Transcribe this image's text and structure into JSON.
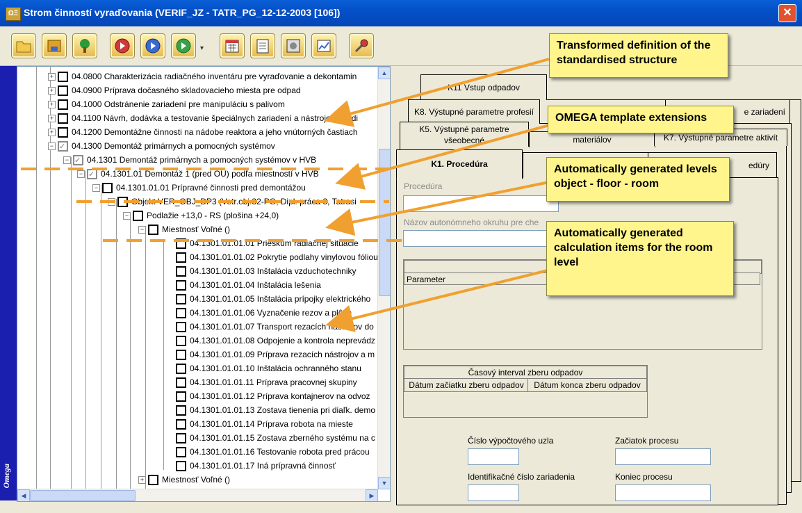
{
  "window": {
    "title": "Strom činností vyraďovania (VERIF_JZ - TATR_PG_12-12-2003 [106])",
    "app_icon": "ΩΞ",
    "close_glyph": "✕"
  },
  "toolbar": {
    "buttons": [
      "folder-open-icon",
      "save-icon",
      "tree-icon",
      "play-red-icon",
      "play-blue-icon",
      "play-green-icon",
      "calendar-icon",
      "document-icon",
      "settings-icon",
      "chart-icon",
      "tools-icon"
    ],
    "dropdown_glyph": "▾"
  },
  "sidebar_logo": "Omega",
  "tree": {
    "rows": [
      {
        "text": "04.0800 Charakterizácia radiačného inventáru pre vyraďovanie a dekontamin"
      },
      {
        "text": "04.0900 Príprava dočasného skladovacieho miesta pre odpad"
      },
      {
        "text": "04.1000 Odstránenie zariadení pre manipuláciu s palivom"
      },
      {
        "text": "04.1100 Návrh, dodávka a testovanie špeciálnych zariadení a nástrojov pre di"
      },
      {
        "text": "04.1200 Demontážne činnosti na nádobe reaktora a jeho vnútorných častiach"
      },
      {
        "text": "04.1300 Demontáž primárnych a pomocných systémov"
      },
      {
        "text": "04.1301 Demontáž primárnych a pomocných systémov v HVB"
      },
      {
        "text": "04.1301.01 Demontáž 1 (pred OU) podľa miestností v HVB"
      },
      {
        "text": "04.1301.01.01 Prípravné činnosti pred demontážou"
      },
      {
        "text": "Objekt VER_OBJ_DP3 (Vetr.obj.32-PG, Dipl. práca 3, Tatrasi"
      },
      {
        "text": "Podlažie +13,0 - RS (plošina +24,0)"
      },
      {
        "text": "Miestnosť Voľné ()"
      },
      {
        "text": "04.1301.01.01.01 Prieskum radiačnej situácie"
      },
      {
        "text": "04.1301.01.01.02 Pokrytie podlahy vinylovou fóliou"
      },
      {
        "text": "04.1301.01.01.03 Inštalácia vzduchotechniky"
      },
      {
        "text": "04.1301.01.01.04 Inštalácia lešenia"
      },
      {
        "text": "04.1301.01.01.05 Inštalácia prípojky elektrického"
      },
      {
        "text": "04.1301.01.01.06 Vyznačenie rezov a plôch"
      },
      {
        "text": "04.1301.01.01.07 Transport rezacích nástrojov do"
      },
      {
        "text": "04.1301.01.01.08 Odpojenie a kontrola neprevádz"
      },
      {
        "text": "04.1301.01.01.09 Príprava rezacích nástrojov a m"
      },
      {
        "text": "04.1301.01.01.10 Inštalácia ochranného stanu"
      },
      {
        "text": "04.1301.01.01.11 Príprava pracovnej skupiny"
      },
      {
        "text": "04.1301.01.01.12 Príprava kontajnerov na odvoz"
      },
      {
        "text": "04.1301.01.01.13 Zostava tienenia pri diaľk. demo"
      },
      {
        "text": "04.1301.01.01.14 Príprava robota na mieste"
      },
      {
        "text": "04.1301.01.01.15 Zostava zberného systému na c"
      },
      {
        "text": "04.1301.01.01.16 Testovanie robota pred prácou"
      },
      {
        "text": "04.1301.01.01.17 Iná prípravná činnosť"
      },
      {
        "text": "Miestnosť Voľné ()"
      }
    ],
    "expand_plus": "+",
    "expand_minus": "−"
  },
  "tabs": {
    "k11": "K11 Vstup odpadov",
    "k8": "K8. Výstupné parametre profesií",
    "k8b": "e zariadení",
    "k5": "K5. Výstupné parametre všeobecné",
    "k5b": "materiálov",
    "k7": "K7. Výstupné parametre aktivít",
    "k1": "K1. Procedúra",
    "k1b": "edúry"
  },
  "form": {
    "procedure_label": "Procedúra",
    "circuit_label": "Názov autonómneho okruhu pre che",
    "param_header": "Parameter",
    "waste_interval": "Časový interval zberu odpadov",
    "waste_start": "Dátum začiatku zberu odpadov",
    "waste_end": "Dátum konca zberu odpadov",
    "calc_node": "Číslo výpočtového uzla",
    "process_start": "Začiatok procesu",
    "device_id": "Identifikačné číslo zariadenia",
    "process_end": "Koniec procesu"
  },
  "callouts": [
    "Transformed definition of the standardised structure",
    "OMEGA template extensions",
    "Automatically generated levels object - floor - room",
    "Automatically generated calculation items for the room level"
  ],
  "colors": {
    "title_bar": "#0450c8",
    "callout_bg": "#fff58c",
    "arrow": "#f0a030",
    "sidebar": "#1a1fb0"
  }
}
